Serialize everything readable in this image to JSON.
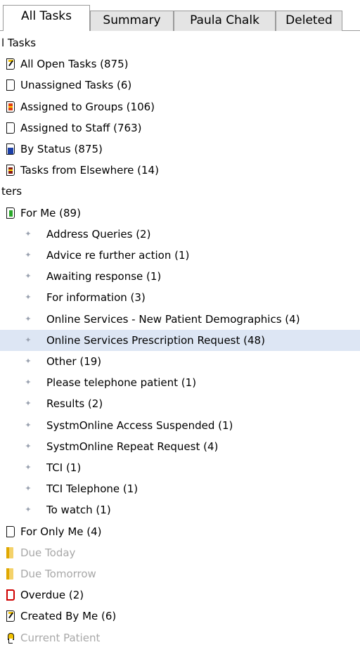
{
  "tabs": [
    {
      "label": "All Tasks",
      "active": true
    },
    {
      "label": "Summary",
      "active": false
    },
    {
      "label": "Paula Chalk",
      "active": false
    },
    {
      "label": "Deleted",
      "active": false
    }
  ],
  "tree": [
    {
      "label": "l Tasks",
      "depth": 0,
      "icon": "none"
    },
    {
      "label": "All Open Tasks (875)",
      "depth": 1,
      "icon": "open-tasks-icon"
    },
    {
      "label": "Unassigned Tasks (6)",
      "depth": 1,
      "icon": "blank-task-icon"
    },
    {
      "label": "Assigned to Groups (106)",
      "depth": 1,
      "icon": "group-task-icon"
    },
    {
      "label": "Assigned to Staff (763)",
      "depth": 1,
      "icon": "blank-task-icon"
    },
    {
      "label": "By Status (875)",
      "depth": 1,
      "icon": "status-task-icon"
    },
    {
      "label": "Tasks from Elsewhere (14)",
      "depth": 1,
      "icon": "elsewhere-task-icon"
    },
    {
      "label": "ters",
      "depth": 0,
      "icon": "none"
    },
    {
      "label": "For Me (89)",
      "depth": 1,
      "icon": "for-me-task-icon"
    },
    {
      "label": "Address Queries (2)",
      "depth": 2,
      "icon": "bullet-icon"
    },
    {
      "label": "Advice re further action (1)",
      "depth": 2,
      "icon": "bullet-icon"
    },
    {
      "label": "Awaiting response (1)",
      "depth": 2,
      "icon": "bullet-icon"
    },
    {
      "label": "For information (3)",
      "depth": 2,
      "icon": "bullet-icon"
    },
    {
      "label": "Online Services - New Patient Demographics (4)",
      "depth": 2,
      "icon": "bullet-icon"
    },
    {
      "label": "Online Services Prescription Request (48)",
      "depth": 2,
      "icon": "bullet-icon",
      "selected": true
    },
    {
      "label": "Other (19)",
      "depth": 2,
      "icon": "bullet-icon"
    },
    {
      "label": "Please telephone patient (1)",
      "depth": 2,
      "icon": "bullet-icon"
    },
    {
      "label": "Results (2)",
      "depth": 2,
      "icon": "bullet-icon"
    },
    {
      "label": "SystmOnline Access Suspended (1)",
      "depth": 2,
      "icon": "bullet-icon"
    },
    {
      "label": "SystmOnline Repeat Request (4)",
      "depth": 2,
      "icon": "bullet-icon"
    },
    {
      "label": "TCI (1)",
      "depth": 2,
      "icon": "bullet-icon"
    },
    {
      "label": "TCI Telephone (1)",
      "depth": 2,
      "icon": "bullet-icon"
    },
    {
      "label": "To watch (1)",
      "depth": 2,
      "icon": "bullet-icon"
    },
    {
      "label": "For Only Me (4)",
      "depth": 1,
      "icon": "blank-task-icon"
    },
    {
      "label": "Due Today",
      "depth": 1,
      "icon": "due-folder-icon",
      "dim": true
    },
    {
      "label": "Due Tomorrow",
      "depth": 1,
      "icon": "due-folder-icon",
      "dim": true
    },
    {
      "label": "Overdue (2)",
      "depth": 1,
      "icon": "overdue-task-icon"
    },
    {
      "label": "Created By Me (6)",
      "depth": 1,
      "icon": "open-tasks-icon"
    },
    {
      "label": "Current Patient",
      "depth": 1,
      "icon": "patient-task-icon",
      "dim": true
    }
  ]
}
